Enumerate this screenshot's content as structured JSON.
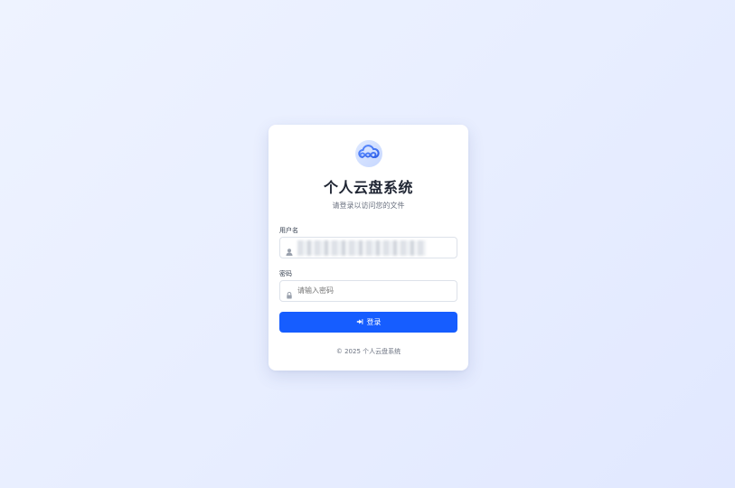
{
  "app": {
    "title": "个人云盘系统",
    "subtitle": "请登录以访问您的文件",
    "logo_icon": "cloud-infinity-icon",
    "accent_color": "#165dff"
  },
  "form": {
    "username": {
      "label": "用户名",
      "value": "",
      "icon": "user-icon",
      "masked": true
    },
    "password": {
      "label": "密码",
      "placeholder": "请输入密码",
      "icon": "lock-icon"
    },
    "submit": {
      "label": "登录",
      "icon": "login-icon"
    }
  },
  "footer": {
    "text": "© 2025 个人云盘系统"
  }
}
